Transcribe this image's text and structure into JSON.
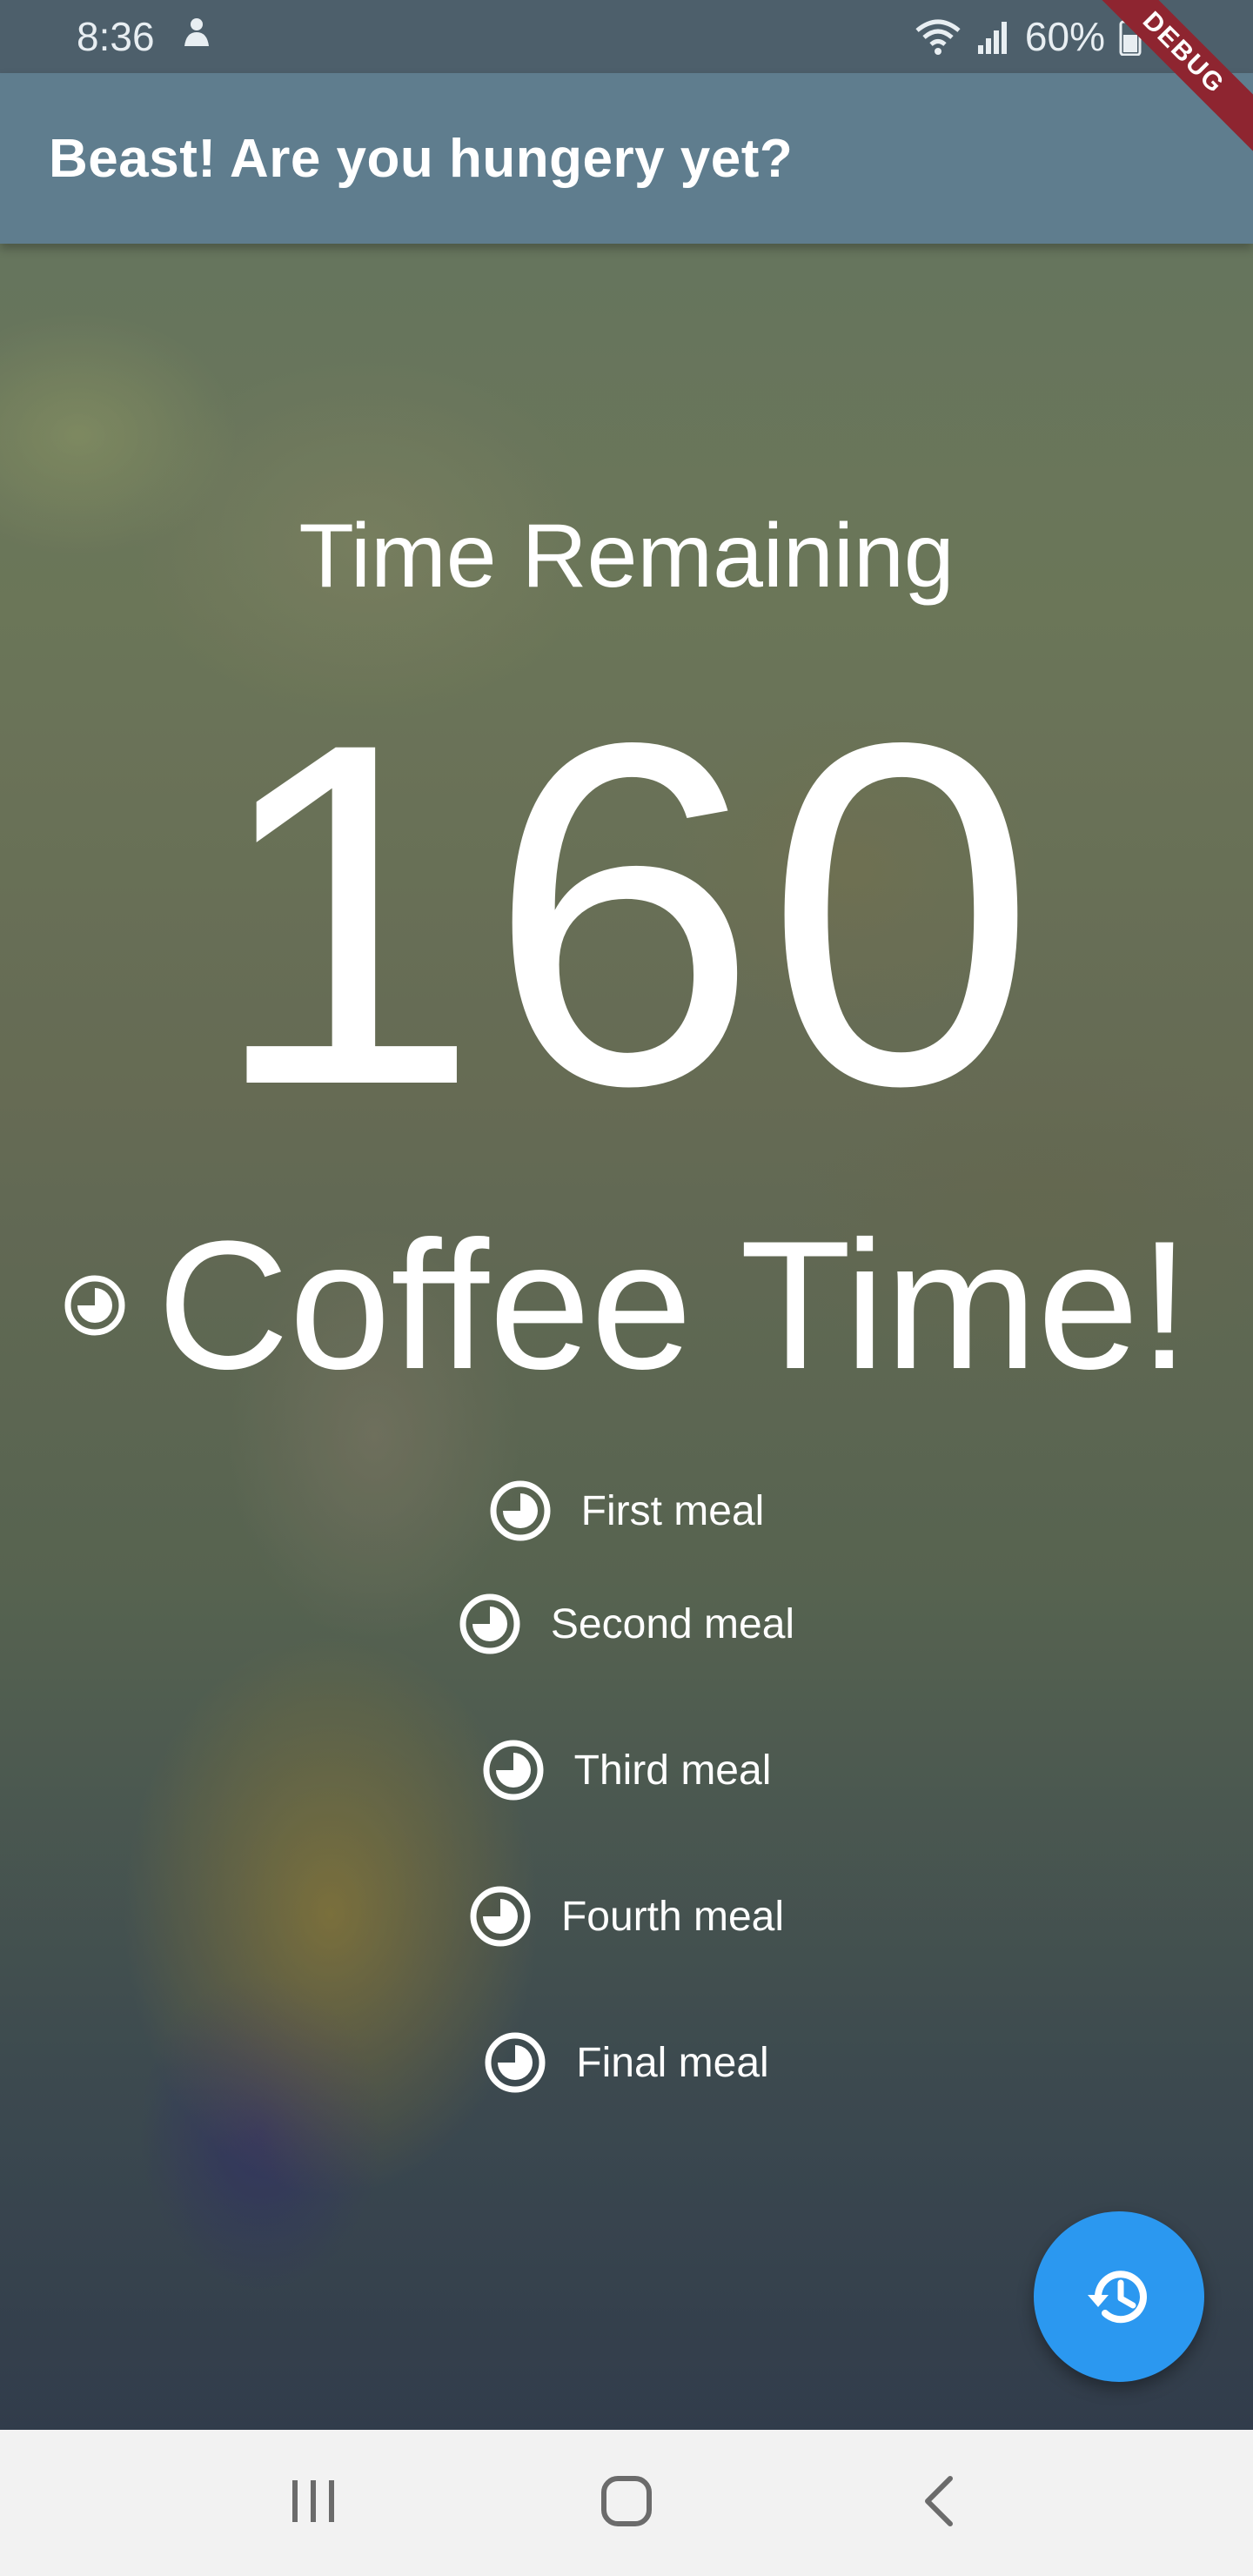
{
  "status_bar": {
    "time": "8:36",
    "notification_icon": "person-notification-icon",
    "wifi_icon": "wifi-icon",
    "signal_icon": "signal-icon",
    "battery_text": "60%",
    "battery_icon": "battery-icon"
  },
  "app_bar": {
    "title": "Beast! Are you hungery yet?",
    "debug_banner": "DEBUG"
  },
  "main": {
    "heading": "Time Remaining",
    "counter": "160",
    "current_meal": "Coffee Time!",
    "meals": [
      {
        "label": "First meal",
        "icon": "timelapse-icon"
      },
      {
        "label": "Second meal",
        "icon": "timelapse-icon"
      },
      {
        "label": "Third meal",
        "icon": "timelapse-icon"
      },
      {
        "label": "Fourth meal",
        "icon": "timelapse-icon"
      },
      {
        "label": "Final meal",
        "icon": "timelapse-icon"
      }
    ]
  },
  "fab": {
    "icon": "history-icon",
    "color": "#2b98f0"
  },
  "nav_bar": {
    "recents_icon": "recents-icon",
    "home_icon": "home-icon",
    "back_icon": "back-icon"
  },
  "colors": {
    "app_bar": "#5f7d8e",
    "status_bar": "#4d5f6b",
    "debug_banner": "#8e2530",
    "text": "#ffffff"
  }
}
